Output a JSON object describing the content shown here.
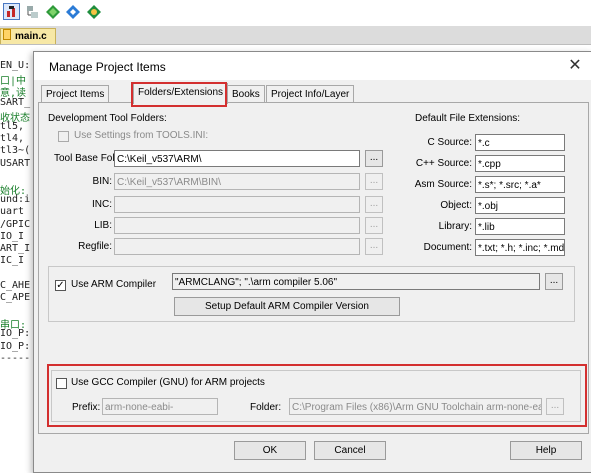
{
  "ide": {
    "file_tab": "main.c",
    "code_lines": [
      "EN_U:",
      "口|中",
      "意,读",
      "SART_",
      "收状态",
      "tl5,",
      "tl4,",
      "tl3~(",
      "USART",
      "",
      "始化:",
      "und:i",
      "uart",
      "/GPIC",
      "IO_I",
      "ART_I",
      "IC_I",
      "",
      "C_AHE",
      "C_APE",
      "",
      "串口:",
      "IO_P:",
      "IO_P:",
      "-----"
    ]
  },
  "dialog": {
    "title": "Manage Project Items",
    "close_glyph": "✕",
    "tabs": [
      "Project Items",
      "Folders/Extensions",
      "Books",
      "Project Info/Layer"
    ],
    "active_tab": "Folders/Extensions",
    "dev_tools": {
      "heading": "Development Tool Folders:",
      "use_settings_label": "Use Settings from TOOLS.INI:",
      "use_settings_checked": false,
      "tool_base_label": "Tool Base Folder:",
      "tool_base_value": "C:\\Keil_v537\\ARM\\",
      "bin_label": "BIN:",
      "bin_value": "C:\\Keil_v537\\ARM\\BIN\\",
      "inc_label": "INC:",
      "inc_value": "",
      "lib_label": "LIB:",
      "lib_value": "",
      "regfile_label": "Regfile:",
      "regfile_value": "",
      "browse": "..."
    },
    "extensions": {
      "heading": "Default File Extensions:",
      "rows": [
        {
          "label": "C Source:",
          "value": "*.c"
        },
        {
          "label": "C++ Source:",
          "value": "*.cpp"
        },
        {
          "label": "Asm Source:",
          "value": "*.s*; *.src; *.a*"
        },
        {
          "label": "Object:",
          "value": "*.obj"
        },
        {
          "label": "Library:",
          "value": "*.lib"
        },
        {
          "label": "Document:",
          "value": "*.txt; *.h; *.inc; *.md"
        }
      ]
    },
    "arm": {
      "use_arm_label": "Use ARM Compiler",
      "use_arm_checked": true,
      "compiler_value": "\"ARMCLANG\"; \".\\arm compiler 5.06\"",
      "setup_button": "Setup Default ARM Compiler Version",
      "browse": "..."
    },
    "gcc": {
      "use_gcc_label": "Use GCC Compiler (GNU) for ARM projects",
      "use_gcc_checked": false,
      "prefix_label": "Prefix:",
      "prefix_value": "arm-none-eabi-",
      "folder_label": "Folder:",
      "folder_value": "C:\\Program Files (x86)\\Arm GNU Toolchain arm-none-eabi\\",
      "browse": "..."
    },
    "buttons": {
      "ok": "OK",
      "cancel": "Cancel",
      "help": "Help"
    },
    "colors": {
      "highlight": "#d32f2f"
    }
  }
}
